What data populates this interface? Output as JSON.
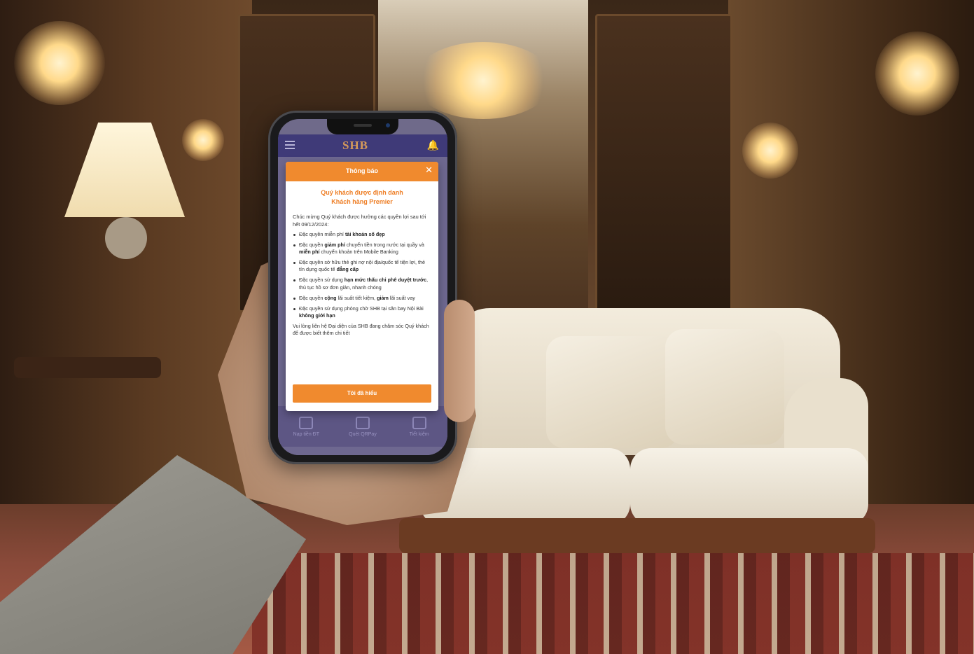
{
  "app": {
    "logo": "SHB",
    "colors": {
      "accent": "#f08a2e",
      "appbar": "#3f3a78"
    }
  },
  "dialog": {
    "title": "Thông báo",
    "headline_line1": "Quý khách được định danh",
    "headline_line2": "Khách hàng Premier",
    "intro": "Chúc mừng Quý khách được hưởng các quyền lợi sau tới hết 09/12/2024:",
    "bullets": [
      {
        "pre": "Đặc quyền miễn phí ",
        "bold": "tài khoản số đẹp",
        "post": ""
      },
      {
        "pre": "Đặc quyền ",
        "bold": "giảm phí",
        "post": " chuyển tiền trong nước tại quầy và ",
        "bold2": "miễn phí",
        "post2": " chuyển khoản trên Mobile Banking"
      },
      {
        "pre": "Đặc quyền sở hữu thẻ ghi nợ nội địa/quốc tế tiện lợi, thẻ tín dụng quốc tế ",
        "bold": "đẳng cấp",
        "post": ""
      },
      {
        "pre": "Đặc quyền sử dụng ",
        "bold": "hạn mức thấu chi phê duyệt trước",
        "post": ", thủ tục hồ sơ đơn giản, nhanh chóng"
      },
      {
        "pre": "Đặc quyền ",
        "bold": "cộng",
        "post": " lãi suất tiết kiệm, ",
        "bold2": "giảm",
        "post2": " lãi suất vay"
      },
      {
        "pre": "Đặc quyền sử dụng phòng chờ SHB tại sân bay Nội Bài ",
        "bold": "không giới hạn",
        "post": ""
      }
    ],
    "outro": "Vui lòng liên hệ Đại diện của SHB đang chăm sóc Quý khách để được biết thêm chi tiết",
    "confirm_label": "Tôi đã hiểu"
  },
  "bottom_nav": [
    "Nạp tiền ĐT",
    "Quét QRPay",
    "Tiết kiệm"
  ]
}
